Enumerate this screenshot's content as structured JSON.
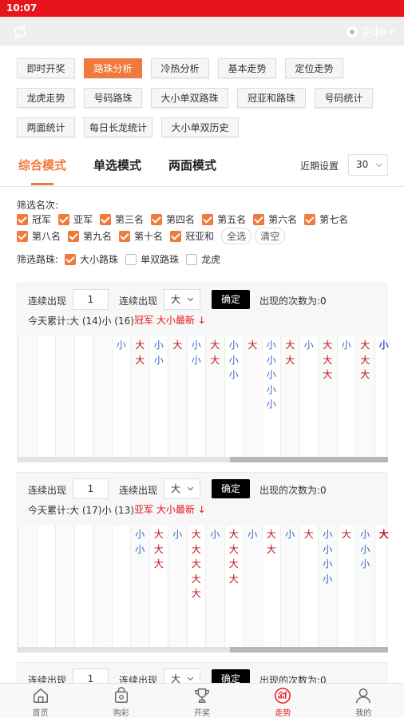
{
  "status_bar": {
    "time": "10:07"
  },
  "navbar": {
    "refresh_icon": "refresh-icon",
    "lottery_label": "彩种"
  },
  "nav_buttons": [
    [
      {
        "label": "即时开奖"
      },
      {
        "label": "路珠分析",
        "active": true
      },
      {
        "label": "冷热分析"
      },
      {
        "label": "基本走势"
      },
      {
        "label": "定位走势"
      }
    ],
    [
      {
        "label": "龙虎走势"
      },
      {
        "label": "号码路珠"
      },
      {
        "label": "大小单双路珠"
      },
      {
        "label": "冠亚和路珠"
      },
      {
        "label": "号码统计"
      }
    ],
    [
      {
        "label": "两面统计"
      },
      {
        "label": "每日长龙统计"
      },
      {
        "label": "大小单双历史"
      }
    ]
  ],
  "modes": {
    "tabs": [
      "综合模式",
      "单选模式",
      "两面模式"
    ],
    "active_index": 0,
    "period_label": "近期设置",
    "period_value": "30"
  },
  "filter_rank": {
    "label": "筛选名次:",
    "row1": [
      "冠军",
      "亚军",
      "第三名",
      "第四名",
      "第五名",
      "第六名",
      "第七名"
    ],
    "row2": [
      "第八名",
      "第九名",
      "第十名",
      "冠亚和"
    ],
    "select_all": "全选",
    "clear": "清空"
  },
  "filter_road": {
    "label": "筛选路珠:",
    "options": [
      {
        "label": "大小路珠",
        "checked": true
      },
      {
        "label": "单双路珠",
        "checked": false
      },
      {
        "label": "龙虎",
        "checked": false
      }
    ]
  },
  "cards": [
    {
      "consecutive_label": "连续出现",
      "count_value": "1",
      "consecutive_label2": "连续出现",
      "size_value": "大",
      "confirm_label": "确定",
      "occurrences_label": "出现的次数为:0",
      "summary": "今天累计:大 (14)小 (16)",
      "latest": "冠军 大小最新 ↓",
      "columns": [
        "",
        "",
        "",
        "",
        "",
        "小",
        "大大",
        "小小",
        "大",
        "小小",
        "大大",
        "小小小",
        "大",
        "小小小小小",
        "大大",
        "小",
        "大大大",
        "小",
        "大大大",
        "小"
      ]
    },
    {
      "consecutive_label": "连续出现",
      "count_value": "1",
      "consecutive_label2": "连续出现",
      "size_value": "大",
      "confirm_label": "确定",
      "occurrences_label": "出现的次数为:0",
      "summary": "今天累计:大 (17)小 (13)",
      "latest": "亚军 大小最新 ↓",
      "columns": [
        "",
        "",
        "",
        "",
        "",
        "",
        "小小",
        "大大大",
        "小",
        "大大大大大",
        "小",
        "大大大大",
        "小",
        "大大",
        "小",
        "大",
        "小小小小",
        "大",
        "小小小",
        "大"
      ]
    },
    {
      "consecutive_label": "连续出现",
      "count_value": "1",
      "consecutive_label2": "连续出现",
      "size_value": "大",
      "confirm_label": "确定",
      "occurrences_label": "出现的次数为:0"
    }
  ],
  "tabbar": [
    {
      "label": "首页",
      "icon": "home-icon"
    },
    {
      "label": "购彩",
      "icon": "lottery-bag-icon"
    },
    {
      "label": "开奖",
      "icon": "trophy-icon"
    },
    {
      "label": "走势",
      "icon": "trend-chart-icon",
      "active": true
    },
    {
      "label": "我的",
      "icon": "user-icon"
    }
  ],
  "colors": {
    "status_red": "#e8141b",
    "accent_orange": "#f07a3b",
    "big_red": "#c0101a",
    "small_blue": "#3a62c8"
  }
}
